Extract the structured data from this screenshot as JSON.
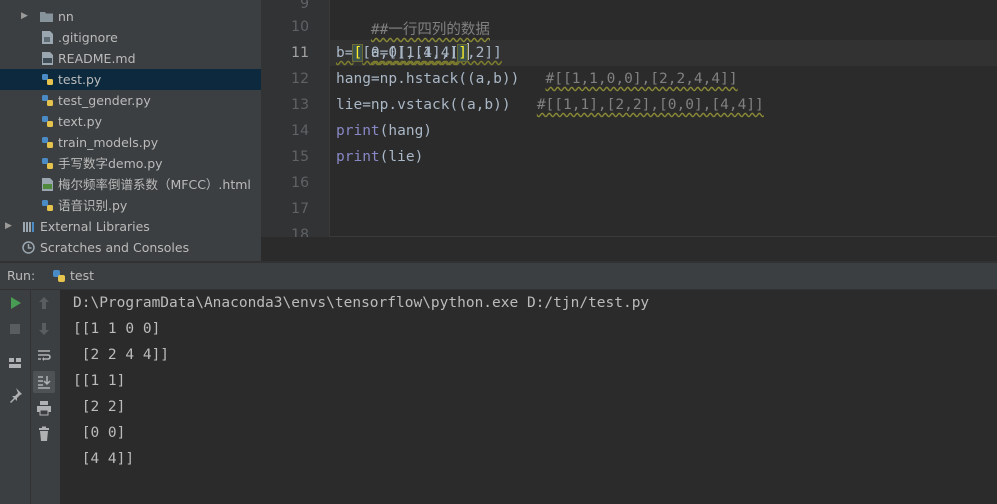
{
  "project_tree": {
    "items": [
      {
        "label": "nn",
        "icon": "folder-icon",
        "expandable": true
      },
      {
        "label": ".gitignore",
        "icon": "gitignore-file-icon"
      },
      {
        "label": "README.md",
        "icon": "markdown-file-icon"
      },
      {
        "label": "test.py",
        "icon": "python-file-icon",
        "selected": true
      },
      {
        "label": "test_gender.py",
        "icon": "python-file-icon"
      },
      {
        "label": "text.py",
        "icon": "python-file-icon"
      },
      {
        "label": "train_models.py",
        "icon": "python-file-icon"
      },
      {
        "label": "手写数字demo.py",
        "icon": "python-file-icon"
      },
      {
        "label": "梅尔频率倒谱系数（MFCC）.html",
        "icon": "html-file-icon"
      },
      {
        "label": "语音识别.py",
        "icon": "python-file-icon"
      },
      {
        "label": "External Libraries",
        "icon": "libraries-icon",
        "expandable": true
      },
      {
        "label": "Scratches and Consoles",
        "icon": "scratches-icon"
      }
    ]
  },
  "editor": {
    "line_numbers": [
      "9",
      "10",
      "11",
      "12",
      "13",
      "14",
      "15",
      "16",
      "17",
      "18"
    ],
    "active_line": "11",
    "lines": {
      "l9": "##一行四列的数据",
      "l10": "a=[[1,1],[2,2]]",
      "l11_a": "b=",
      "l11_b": "[",
      "l11_c": "[0,0],[4,4]",
      "l11_d": "]",
      "l12_code": "hang=np.hstack((a,b))",
      "l12_comment": "#[[1,1,0,0],[2,2,4,4]]",
      "l13_code": "lie=np.vstack((a,b))",
      "l13_comment": "#[[1,1],[2,2],[0,0],[4,4]]",
      "l14_fn": "print",
      "l14_rest": "(hang)",
      "l15_fn": "print",
      "l15_rest": "(lie)"
    }
  },
  "run_panel": {
    "label": "Run:",
    "tab_label": "test",
    "toolbar": [
      "run-icon",
      "stop-icon",
      "up-arrow-icon",
      "down-arrow-icon",
      "layout-icon",
      "soft-wrap-icon",
      "pin-icon",
      "scroll-to-end-icon",
      "print-icon",
      "trash-icon"
    ],
    "output": [
      "D:\\ProgramData\\Anaconda3\\envs\\tensorflow\\python.exe D:/tjn/test.py",
      "[[1 1 0 0]",
      " [2 2 4 4]]",
      "[[1 1]",
      " [2 2]",
      " [0 0]",
      " [4 4]]"
    ]
  },
  "colors": {
    "background": "#2b2b2b",
    "panel": "#3c3f41",
    "selection": "#0d293e",
    "code": "#a9b7c6",
    "comment": "#808080",
    "builtin": "#8888c6",
    "run_green": "#499c54"
  }
}
